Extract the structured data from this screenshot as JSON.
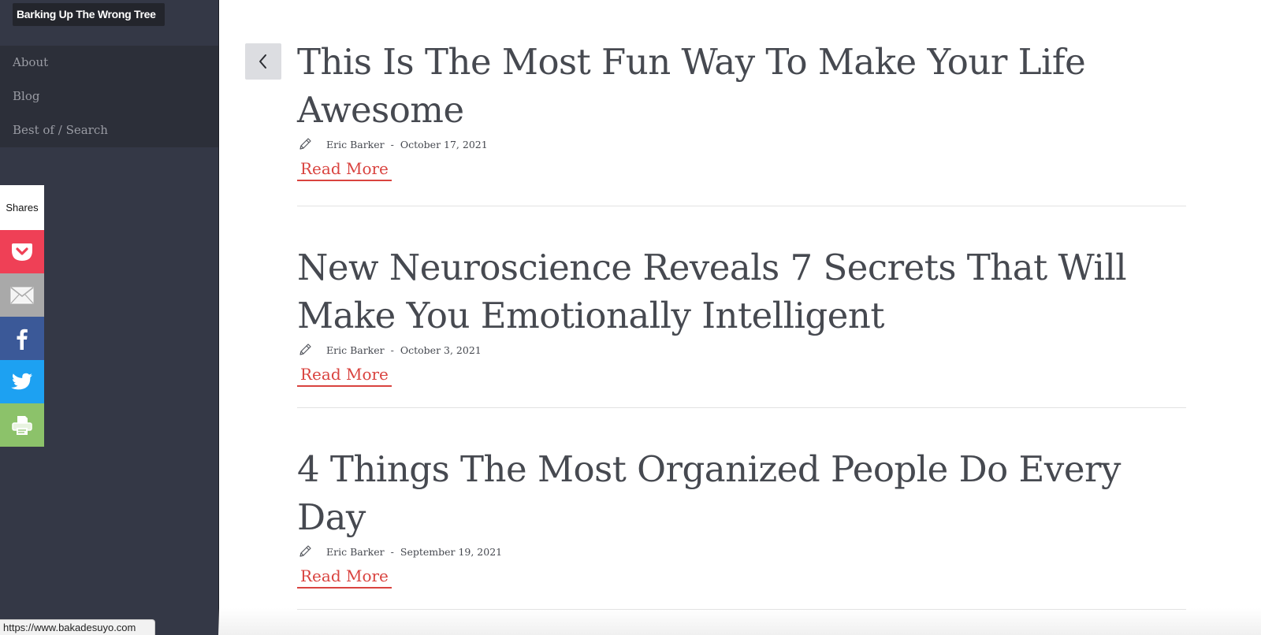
{
  "site": {
    "title": "Barking Up The Wrong Tree"
  },
  "nav": {
    "items": [
      {
        "label": "About"
      },
      {
        "label": "Blog"
      },
      {
        "label": "Best of / Search"
      }
    ]
  },
  "share": {
    "label": "Shares",
    "buttons": [
      {
        "icon": "pocket-icon",
        "color": "#ef4056"
      },
      {
        "icon": "email-icon",
        "color": "#a9a9a9"
      },
      {
        "icon": "facebook-icon",
        "color": "#3b5998"
      },
      {
        "icon": "twitter-icon",
        "color": "#1da1f2"
      },
      {
        "icon": "print-icon",
        "color": "#8cc26a"
      }
    ]
  },
  "posts": [
    {
      "title": "This Is The Most Fun Way To Make Your Life Awesome",
      "author": "Eric Barker",
      "separator": "-",
      "date": "October 17, 2021",
      "read_more": "Read More"
    },
    {
      "title": "New Neuroscience Reveals 7 Secrets That Will Make You Emotionally Intelligent",
      "author": "Eric Barker",
      "separator": "-",
      "date": "October 3, 2021",
      "read_more": "Read More"
    },
    {
      "title": "4 Things The Most Organized People Do Every Day",
      "author": "Eric Barker",
      "separator": "-",
      "date": "September 19, 2021",
      "read_more": "Read More"
    }
  ],
  "status_bar": {
    "url": "https://www.bakadesuyo.com"
  },
  "colors": {
    "sidebar": "#343846",
    "accent": "#d9433f",
    "title_text": "#464950"
  }
}
